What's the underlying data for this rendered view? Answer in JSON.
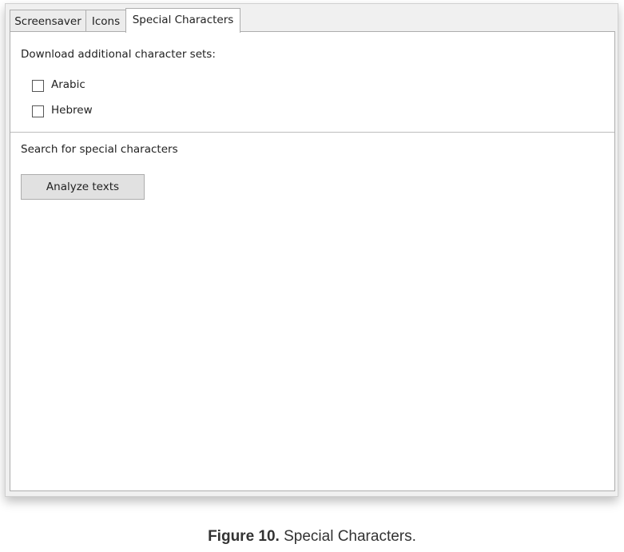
{
  "tabs": [
    {
      "label": "Screensaver"
    },
    {
      "label": "Icons"
    },
    {
      "label": "Special Characters"
    }
  ],
  "active_tab": "Special Characters",
  "download_section": {
    "heading": "Download additional character sets:",
    "options": [
      {
        "label": "Arabic",
        "checked": false
      },
      {
        "label": "Hebrew",
        "checked": false
      }
    ]
  },
  "search_section": {
    "heading": "Search for special characters",
    "button_label": "Analyze texts"
  },
  "caption": {
    "bold": "Figure 10.",
    "text": " Special Characters."
  }
}
